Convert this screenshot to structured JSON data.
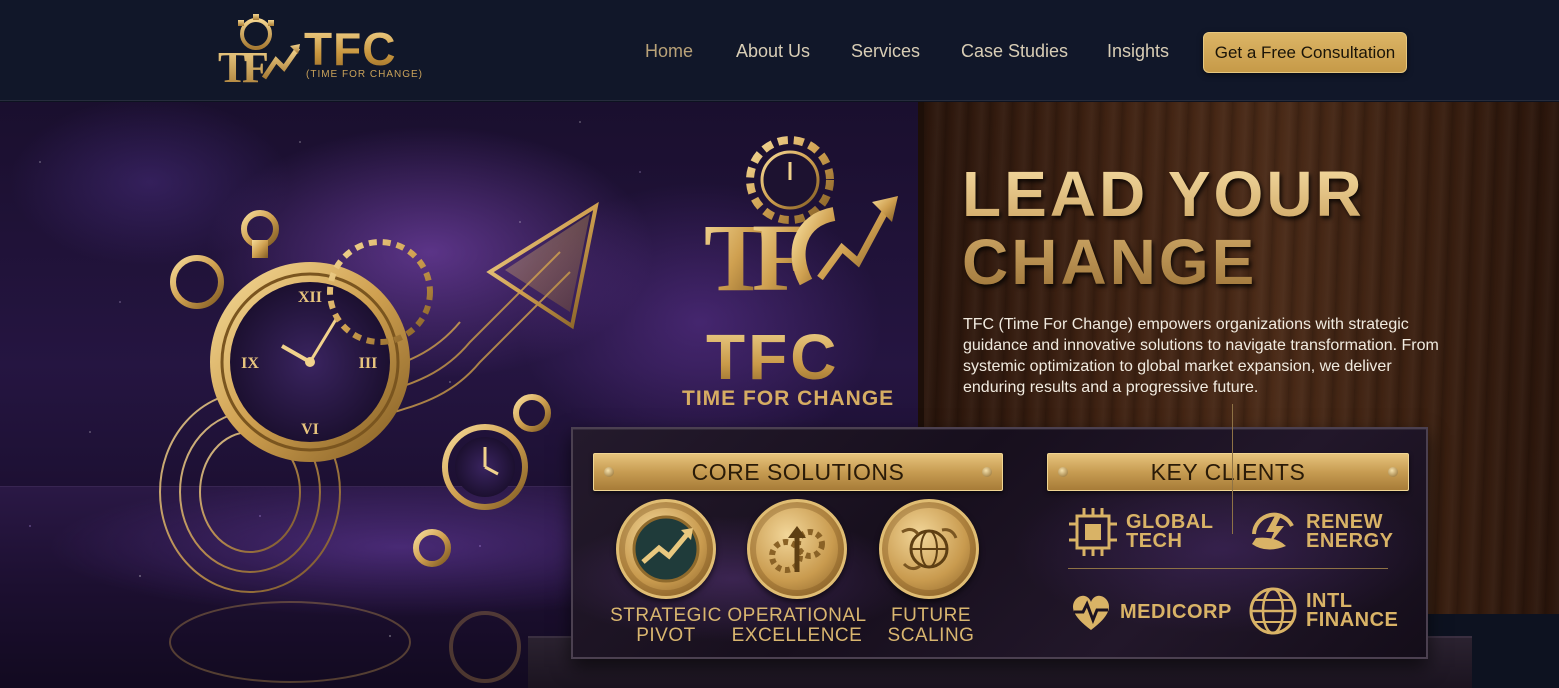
{
  "header": {
    "brand_name": "TFC",
    "brand_tagline": "(TIME FOR CHANGE)",
    "nav": [
      {
        "label": "Home",
        "active": true
      },
      {
        "label": "About Us",
        "active": false
      },
      {
        "label": "Services",
        "active": false
      },
      {
        "label": "Case Studies",
        "active": false
      },
      {
        "label": "Insights",
        "active": false
      }
    ],
    "cta_label": "Get a Free Consultation"
  },
  "hero": {
    "title_line1": "LEAD YOUR",
    "title_line2": "CHANGE",
    "description": "TFC (Time For Change) empowers organizations with strategic guidance and innovative solutions to navigate transformation. From systemic optimization to global market expansion, we deliver enduring results and a progressive future.",
    "center_logo": "TFC",
    "center_tagline": "TIME FOR CHANGE"
  },
  "core_solutions": {
    "heading": "CORE SOLUTIONS",
    "items": [
      {
        "line1": "STRATEGIC",
        "line2": "PIVOT",
        "icon": "growth-arrow-icon"
      },
      {
        "line1": "OPERATIONAL",
        "line2": "EXCELLENCE",
        "icon": "gears-arrow-icon"
      },
      {
        "line1": "FUTURE",
        "line2": "SCALING",
        "icon": "globe-map-icon"
      }
    ]
  },
  "key_clients": {
    "heading": "KEY CLIENTS",
    "items": [
      {
        "line1": "GLOBAL",
        "line2": "TECH",
        "icon": "chip-icon"
      },
      {
        "line1": "RENEW",
        "line2": "ENERGY",
        "icon": "leaf-bolt-icon"
      },
      {
        "line1": "MEDICORP",
        "line2": "",
        "icon": "heart-pulse-icon"
      },
      {
        "line1": "INTL",
        "line2": "FINANCE",
        "icon": "globe-icon"
      }
    ]
  },
  "colors": {
    "gold": "#d4ac5e",
    "navy": "#111729",
    "purple": "#251541",
    "wood": "#3f2212"
  }
}
